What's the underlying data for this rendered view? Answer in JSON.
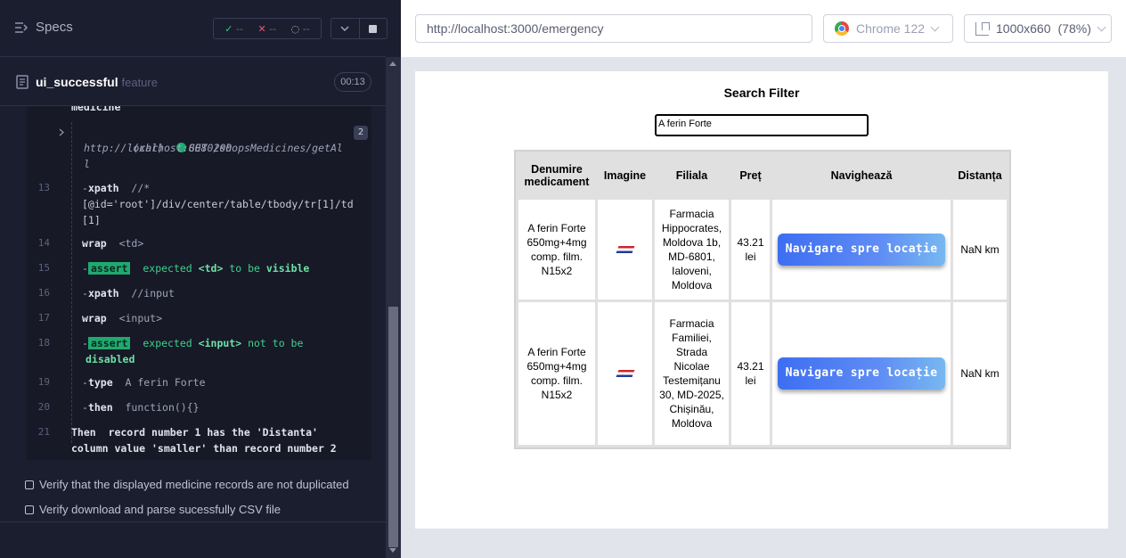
{
  "reporter": {
    "specs_label": "Specs",
    "stats": {
      "passed": "--",
      "failed": "--",
      "pending": "--"
    },
    "spec": {
      "name": "ui_successful",
      "ext": "feature",
      "duration": "00:13"
    },
    "log": {
      "partial_top": "medicine",
      "xhr": {
        "type": "(xhr)",
        "status": "GET 200",
        "url_line1": "http://localhost:8080/shopsMedicines/getAl",
        "url_line2": "l",
        "count": "2"
      },
      "lines": [
        {
          "num": "13",
          "cmd": "xpath",
          "arg1": "//*",
          "arg2": "[@id='root']/div/center/table/tbody/tr[1]/td",
          "arg3": "[1]"
        },
        {
          "num": "14",
          "cmd": "wrap",
          "arg": "<td>"
        },
        {
          "num": "15",
          "cmd": "assert",
          "pre": "expected",
          "target": "<td>",
          "mid": "to be",
          "val": "visible"
        },
        {
          "num": "16",
          "cmd": "xpath",
          "arg": "//input"
        },
        {
          "num": "17",
          "cmd": "wrap",
          "arg": "<input>"
        },
        {
          "num": "18",
          "cmd": "assert",
          "pre": "expected",
          "target": "<input>",
          "mid": "not to be",
          "val": "disabled"
        },
        {
          "num": "19",
          "cmd": "type",
          "arg": "A ferin Forte"
        },
        {
          "num": "20",
          "cmd": "then",
          "arg": "function(){}"
        },
        {
          "num": "21",
          "line1": "Then  record number 1 has the 'Distanta'",
          "line2": "column value 'smaller' than record number 2"
        }
      ]
    },
    "tests": [
      "Verify that the displayed medicine records are not duplicated",
      "Verify download and parse sucessfully CSV file"
    ]
  },
  "browser_bar": {
    "url": "http://localhost:3000/emergency",
    "browser": "Chrome 122",
    "viewport": "1000x660",
    "zoom": "(78%)"
  },
  "app": {
    "title": "Search Filter",
    "search_value": "A ferin Forte",
    "headers": [
      "Denumire medicament",
      "Imagine",
      "Filiala",
      "Preț",
      "Navighează",
      "Distanța"
    ],
    "rows": [
      {
        "name": "A ferin Forte 650mg+4mg comp. film. N15x2",
        "filiala": "Farmacia Hippocrates, Moldova 1b, MD-6801, Ialoveni, Moldova",
        "price": "43.21 lei",
        "nav": "Navigare spre locație",
        "dist": "NaN km"
      },
      {
        "name": "A ferin Forte 650mg+4mg comp. film. N15x2",
        "filiala": "Farmacia Familiei, Strada Nicolae Testemițanu 30, MD-2025, Chișinău, Moldova",
        "price": "43.21 lei",
        "nav": "Navigare spre locație",
        "dist": "NaN km"
      }
    ]
  }
}
